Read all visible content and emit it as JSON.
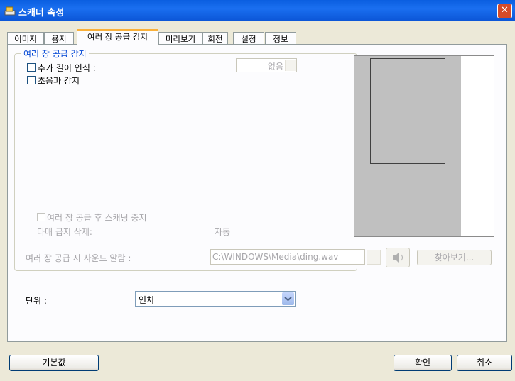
{
  "window": {
    "title": "스캐너 속성",
    "close_symbol": "✕"
  },
  "tabs": [
    {
      "label": "이미지"
    },
    {
      "label": "용지"
    },
    {
      "label": "여러 장 공급 감지"
    },
    {
      "label": "미리보기"
    },
    {
      "label": "회전"
    },
    {
      "label": "설정"
    },
    {
      "label": "정보"
    }
  ],
  "group": {
    "title": "여러 장 공급 감지",
    "extra_length_label": "추가 길이 인식 :",
    "extra_length_value": "없음",
    "ultrasonic_label": "초음파 감지",
    "stop_after_label": "여러 장 공급 후 스캐닝 중지",
    "multi_delete_label": "다매 급지 삭제:",
    "multi_delete_value": "자동",
    "sound_label": "여러 장 공급 시 사운드 알람 :",
    "sound_path": "C:\\WINDOWS\\Media\\ding.wav",
    "browse_label": "찾아보기..."
  },
  "unit": {
    "label": "단위 :",
    "value": "인치"
  },
  "buttons": {
    "default": "기본값",
    "ok": "확인",
    "cancel": "취소"
  }
}
